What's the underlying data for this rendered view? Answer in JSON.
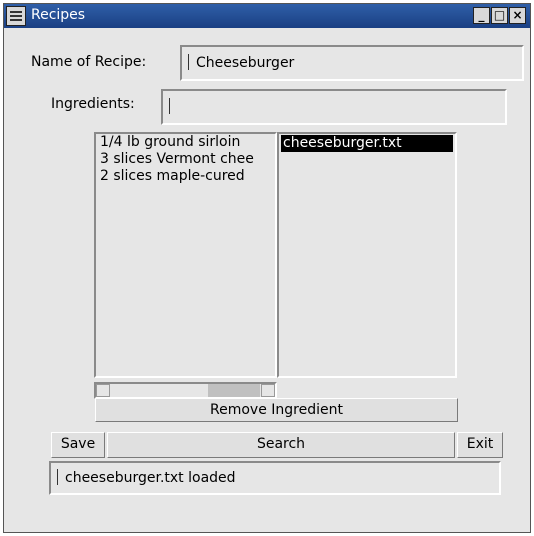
{
  "window": {
    "title": "Recipes"
  },
  "form": {
    "name_label": "Name of Recipe:",
    "name_value": "Cheeseburger",
    "ingredients_label": "Ingredients:",
    "ingredients_value": ""
  },
  "ingredients_list": [
    "1/4 lb ground sirloin",
    "3 slices Vermont chee",
    "2 slices maple-cured"
  ],
  "files_list": {
    "items": [
      "cheeseburger.txt"
    ],
    "selected": "cheeseburger.txt"
  },
  "buttons": {
    "remove_ingredient": "Remove Ingredient",
    "save": "Save",
    "search": "Search",
    "exit": "Exit"
  },
  "status": "cheeseburger.txt loaded"
}
